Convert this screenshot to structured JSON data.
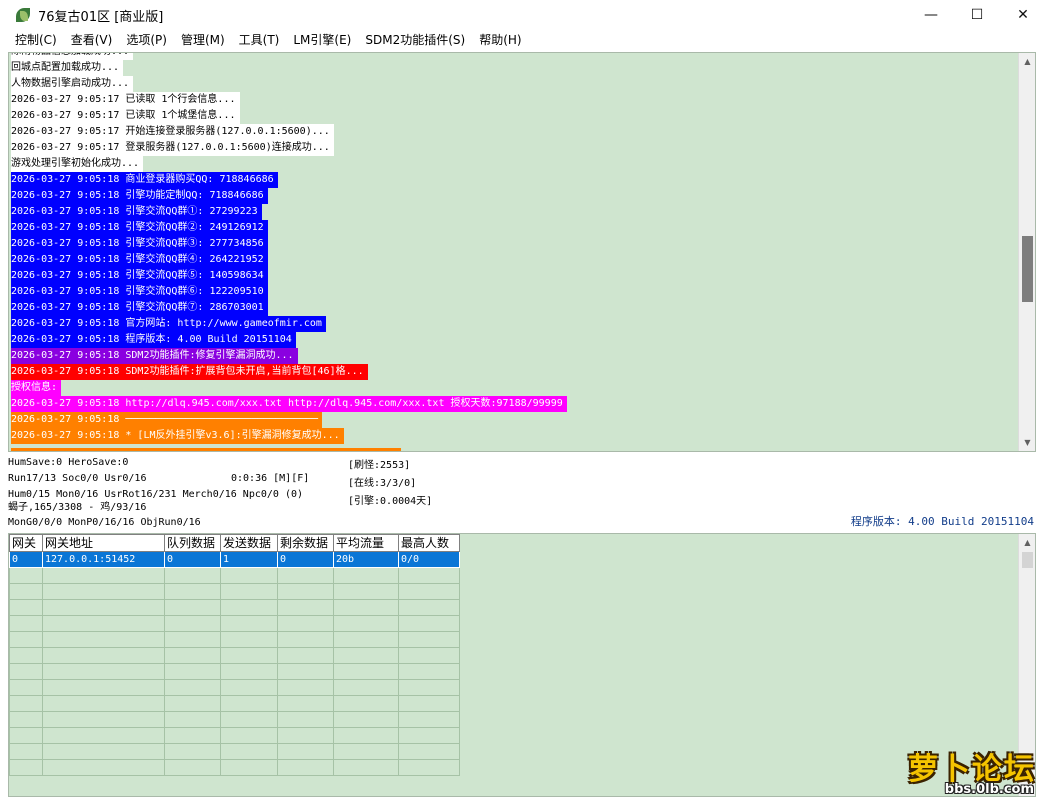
{
  "window": {
    "title": "76复古01区 [商业版]",
    "minimize": "—",
    "maximize": "☐",
    "close": "✕"
  },
  "menu": [
    "控制(C)",
    "查看(V)",
    "选项(P)",
    "管理(M)",
    "工具(T)",
    "LM引擎(E)",
    "SDM2功能插件(S)",
    "帮助(H)"
  ],
  "log": [
    {
      "text": "除雨物品信息加载成功...",
      "bg": "#ffffff",
      "fg": "#000000"
    },
    {
      "text": "回城点配置加载成功...",
      "bg": "#ffffff",
      "fg": "#000000"
    },
    {
      "text": "人物数据引擎启动成功...",
      "bg": "#ffffff",
      "fg": "#000000"
    },
    {
      "text": "2026-03-27 9:05:17 已读取 1个行会信息...",
      "bg": "#ffffff",
      "fg": "#000000"
    },
    {
      "text": "2026-03-27 9:05:17 已读取 1个城堡信息...",
      "bg": "#ffffff",
      "fg": "#000000"
    },
    {
      "text": "2026-03-27 9:05:17 开始连接登录服务器(127.0.0.1:5600)...",
      "bg": "#ffffff",
      "fg": "#000000"
    },
    {
      "text": "2026-03-27 9:05:17 登录服务器(127.0.0.1:5600)连接成功...",
      "bg": "#ffffff",
      "fg": "#000000"
    },
    {
      "text": "游戏处理引擎初始化成功...",
      "bg": "#ffffff",
      "fg": "#000000"
    },
    {
      "text": "2026-03-27 9:05:18 商业登录器购买QQ: 718846686",
      "bg": "#0000ff",
      "fg": "#ffffff"
    },
    {
      "text": "2026-03-27 9:05:18 引擎功能定制QQ: 718846686",
      "bg": "#0000ff",
      "fg": "#ffffff"
    },
    {
      "text": "2026-03-27 9:05:18 引擎交流QQ群①: 27299223",
      "bg": "#0000ff",
      "fg": "#ffffff"
    },
    {
      "text": "2026-03-27 9:05:18 引擎交流QQ群②: 249126912",
      "bg": "#0000ff",
      "fg": "#ffffff"
    },
    {
      "text": "2026-03-27 9:05:18 引擎交流QQ群③: 277734856",
      "bg": "#0000ff",
      "fg": "#ffffff"
    },
    {
      "text": "2026-03-27 9:05:18 引擎交流QQ群④: 264221952",
      "bg": "#0000ff",
      "fg": "#ffffff"
    },
    {
      "text": "2026-03-27 9:05:18 引擎交流QQ群⑤: 140598634",
      "bg": "#0000ff",
      "fg": "#ffffff"
    },
    {
      "text": "2026-03-27 9:05:18 引擎交流QQ群⑥: 122209510",
      "bg": "#0000ff",
      "fg": "#ffffff"
    },
    {
      "text": "2026-03-27 9:05:18 引擎交流QQ群⑦: 286703001",
      "bg": "#0000ff",
      "fg": "#ffffff"
    },
    {
      "text": "2026-03-27 9:05:18 官方网站: http://www.gameofmir.com",
      "bg": "#0000ff",
      "fg": "#ffffff"
    },
    {
      "text": "2026-03-27 9:05:18 程序版本: 4.00 Build 20151104",
      "bg": "#0000ff",
      "fg": "#ffffff"
    },
    {
      "text": "2026-03-27 9:05:18 SDM2功能插件:修复引擎漏洞成功...",
      "bg": "#8a00e0",
      "fg": "#ffffff"
    },
    {
      "text": "2026-03-27 9:05:18 SDM2功能插件:扩展背包未开启,当前背包[46]格...",
      "bg": "#ff0000",
      "fg": "#ffffff"
    },
    {
      "text": "授权信息:",
      "bg": "#ff00ff",
      "fg": "#ffffff"
    },
    {
      "text": "2026-03-27 9:05:18 http://dlq.945.com/xxx.txt http://dlq.945.com/xxx.txt 授权天数:97188/99999",
      "bg": "#ff00ff",
      "fg": "#ffffff"
    },
    {
      "text": "2026-03-27 9:05:18 ────────────────────────────────",
      "bg": "#ff8000",
      "fg": "#ffffff"
    },
    {
      "text": "2026-03-27 9:05:18 * [LM反外挂引擎v3.6]:引擎漏洞修复成功...",
      "bg": "#ff8000",
      "fg": "#ffffff"
    },
    {
      "text": "",
      "bg": "#ff8000",
      "fg": "#ffffff"
    }
  ],
  "status": {
    "line1": "HumSave:0 HeroSave:0",
    "line2": "Run17/13 Soc0/0 Usr0/16",
    "line2b": "0:0:36 [M][F]",
    "line3": "Hum0/15 Mon0/16 UsrRot16/231 Merch0/16 Npc0/0 (0)",
    "line4": "蝎子,165/3308 - 鸡/93/16",
    "line5": "MonG0/0/0 MonP0/16/16 ObjRun0/16",
    "box1": "[刷怪:2553]",
    "box2": "[在线:3/3/0]",
    "box3": "[引擎:0.0004天]",
    "version": "程序版本: 4.00 Build 20151104"
  },
  "grid": {
    "headers": [
      "网关",
      "网关地址",
      "队列数据",
      "发送数据",
      "剩余数据",
      "平均流量",
      "最高人数"
    ],
    "rows": [
      [
        "0",
        "127.0.0.1:51452",
        "0",
        "1",
        "0",
        "20b",
        "0/0"
      ]
    ],
    "empty_rows": 13
  },
  "watermark": {
    "main": "萝卜论坛",
    "sub": "bbs.0lb.com"
  }
}
